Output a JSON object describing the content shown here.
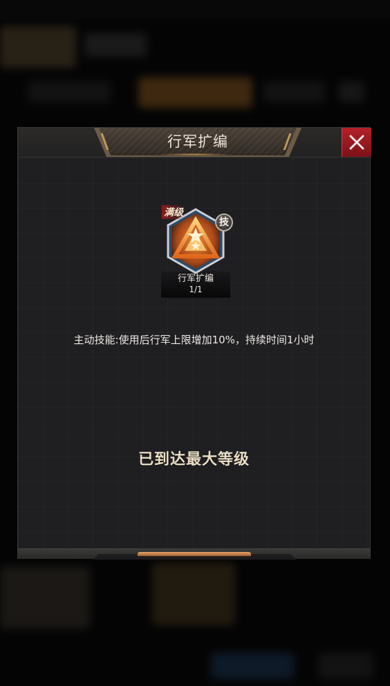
{
  "dialog": {
    "title": "行军扩编",
    "close_icon": "close-icon"
  },
  "skill": {
    "maxed_label": "满级",
    "tag": "技",
    "name": "行军扩编",
    "level": "1/1",
    "icon": "triangle-star-emblem-icon"
  },
  "description": "主动技能:使用后行军上限增加10%，持续时间1小时",
  "status": "已到达最大等级",
  "colors": {
    "accent_gold": "#c59a5a",
    "close_red": "#b3212a",
    "emblem_orange": "#e8772a",
    "panel": "#1f1f22"
  }
}
